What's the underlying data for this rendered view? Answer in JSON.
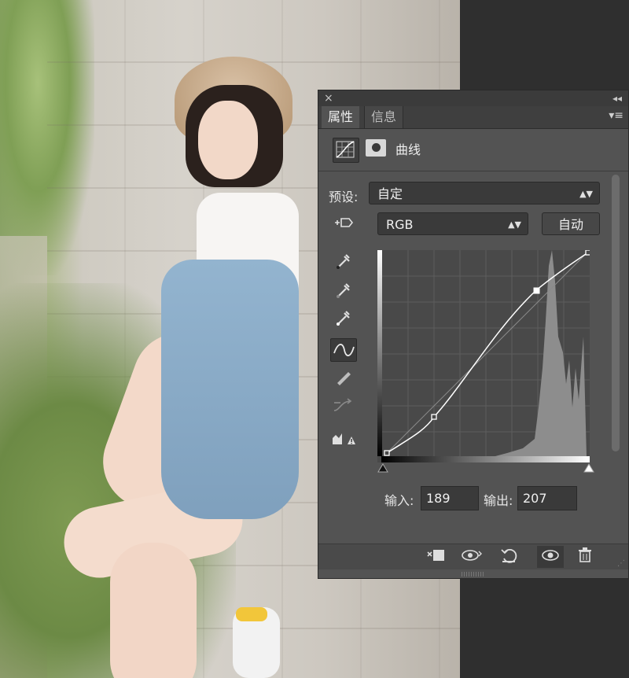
{
  "panel": {
    "close_icon": "×",
    "collapse_icon": "◂◂",
    "tabs": [
      {
        "label": "属性"
      },
      {
        "label": "信息"
      }
    ],
    "menu_icon": "▾≡",
    "header_title": "曲线",
    "preset_label": "预设:",
    "preset_value": "自定",
    "channel_value": "RGB",
    "auto_label": "自动",
    "input_label": "输入:",
    "input_value": "189",
    "output_label": "输出:",
    "output_value": "207"
  },
  "icons": {
    "adjustment": "curves-adjustment-icon",
    "mask": "mask-icon",
    "on_image": "on-image-adjust-icon",
    "eyedropper_black": "eyedropper-black-icon",
    "eyedropper_gray": "eyedropper-gray-icon",
    "eyedropper_white": "eyedropper-white-icon",
    "curve_tool": "curve-point-tool-icon",
    "pencil": "pencil-icon",
    "smooth": "smooth-curve-icon",
    "clipping": "clipping-warning-icon"
  },
  "colors": {
    "panel_bg": "#535353",
    "graph_bg": "#494949",
    "curve": "#ffffff"
  }
}
